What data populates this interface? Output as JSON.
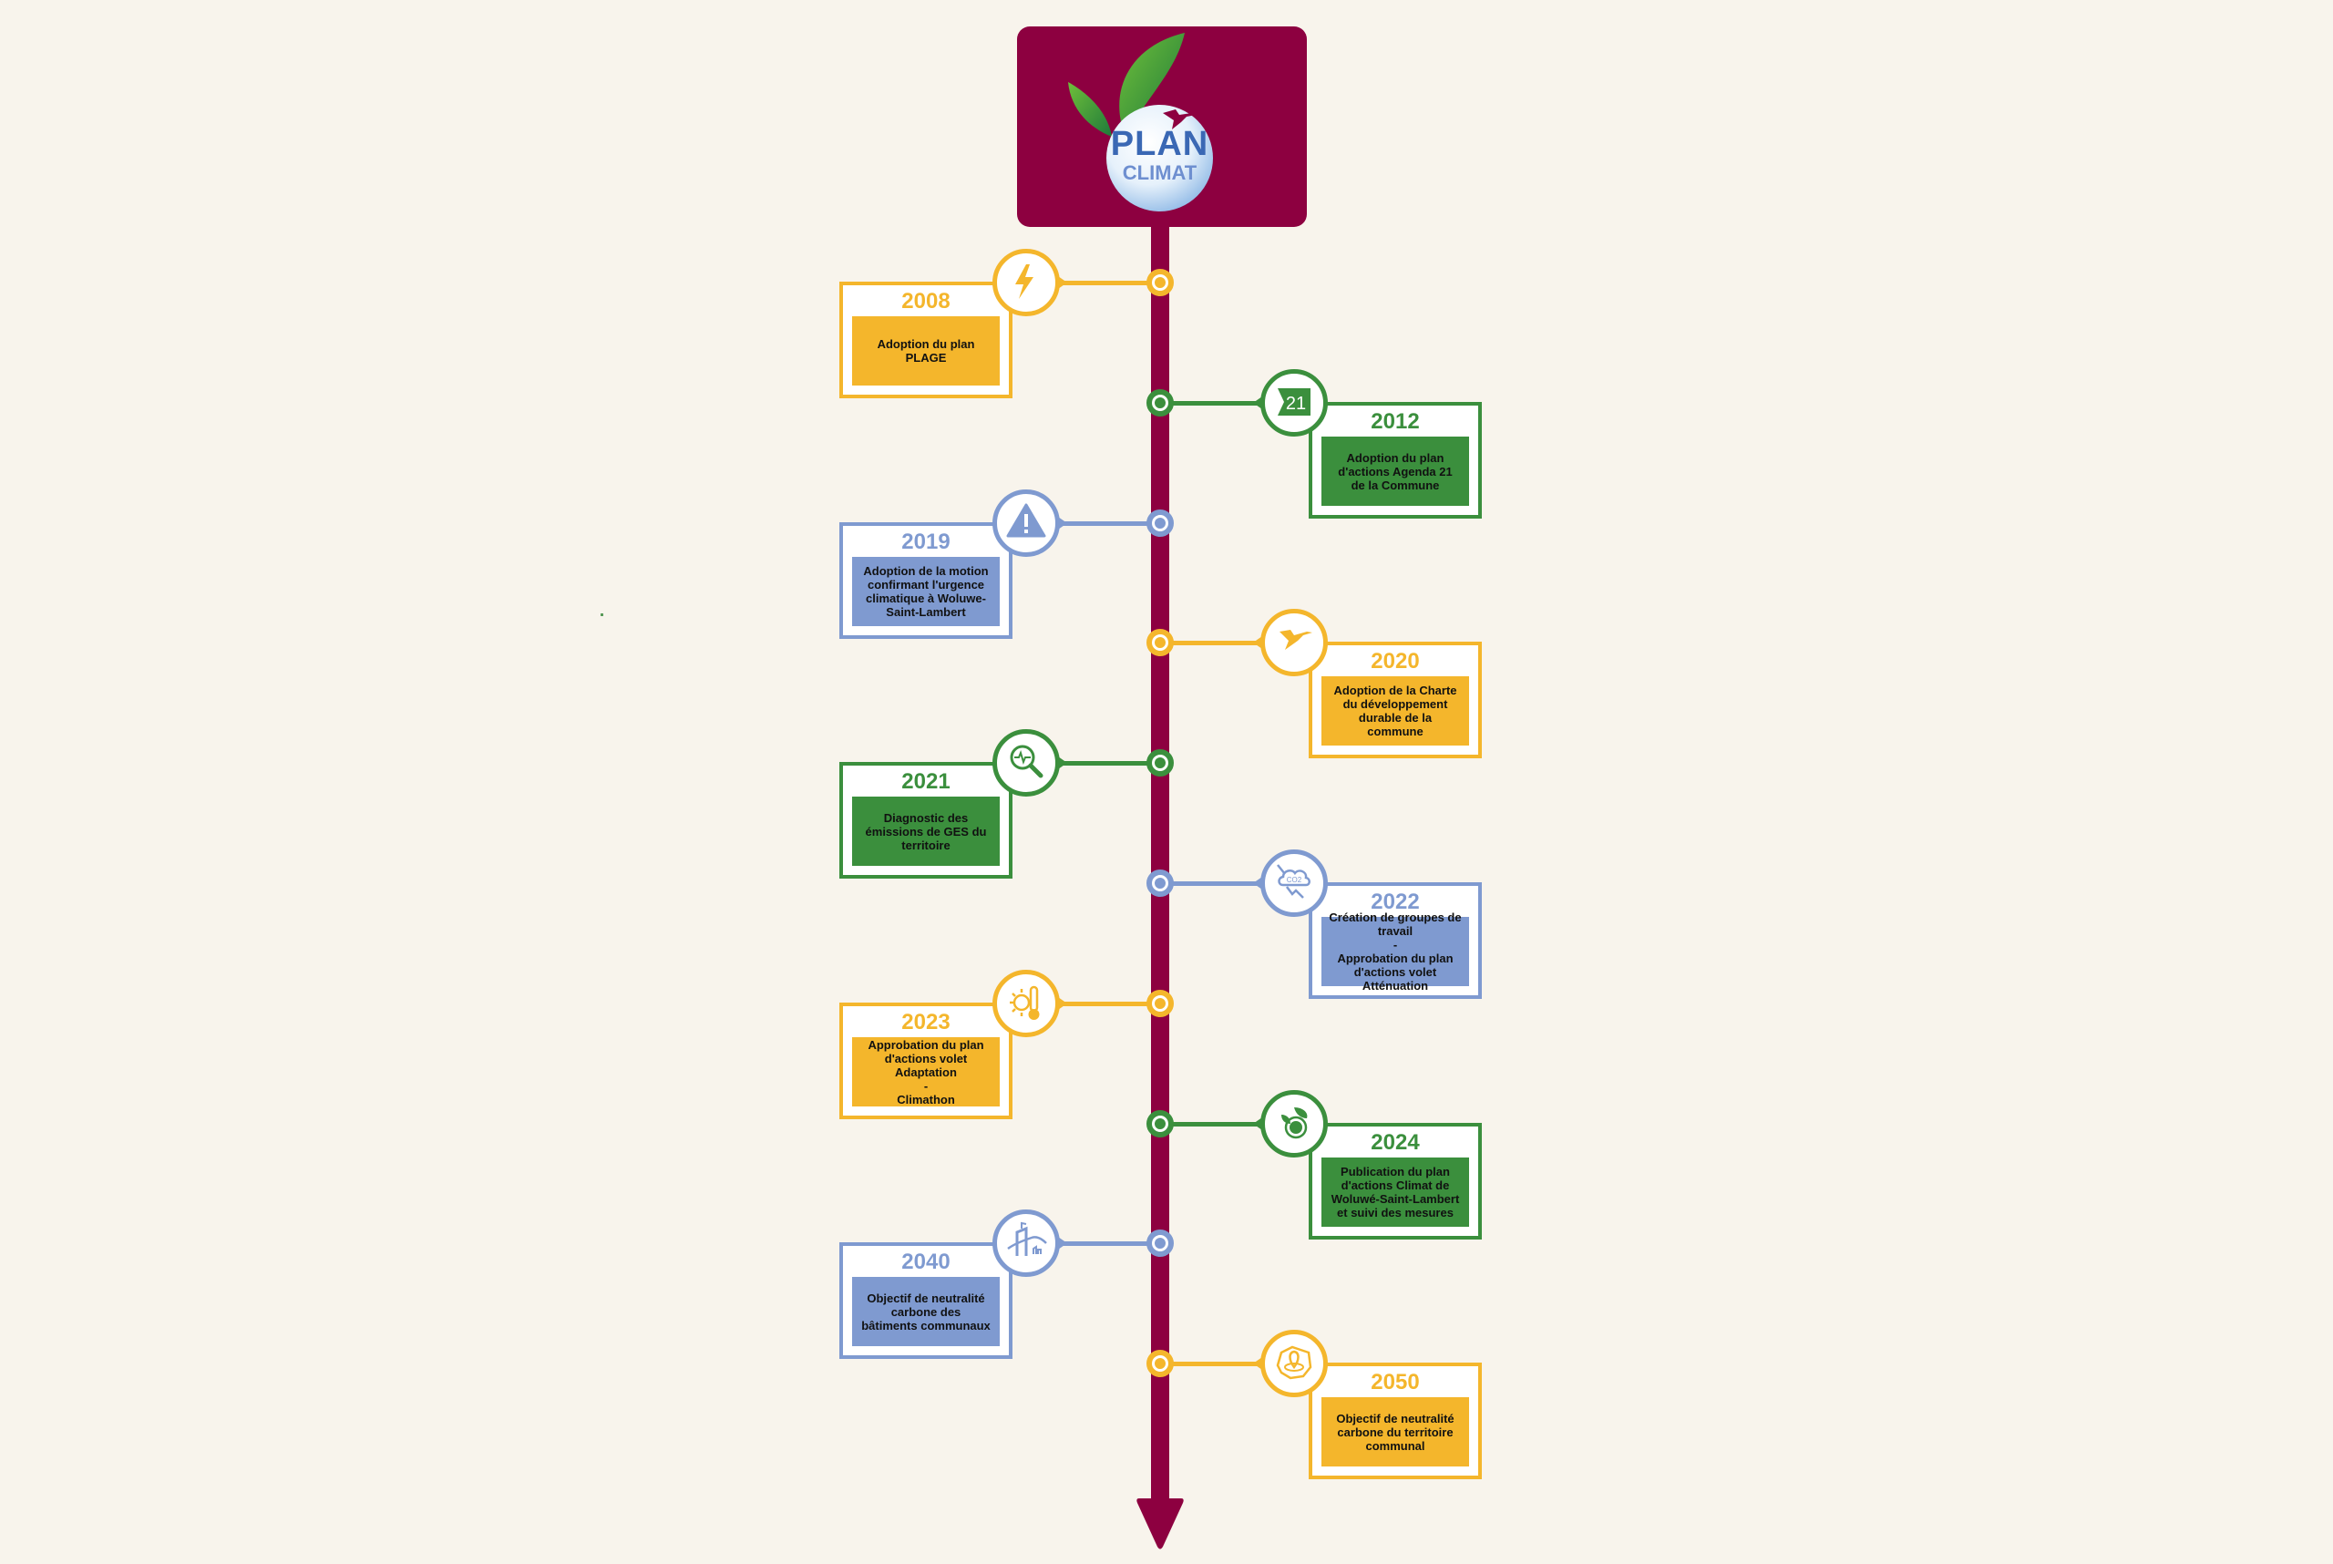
{
  "title": {
    "line1": "PLAN",
    "line2": "CLIMAT"
  },
  "colors": {
    "background": "#f8f4ec",
    "spine": "#8d0040",
    "yellow": "#f4b62c",
    "green": "#3b8f3d",
    "blue": "#7f9ad0"
  },
  "events": [
    {
      "year": "2008",
      "side": "left",
      "color": "yellow",
      "icon": "lightning-icon",
      "text": "Adoption du plan\nPLAGE"
    },
    {
      "year": "2012",
      "side": "right",
      "color": "green",
      "icon": "agenda-21-icon",
      "icon_text": "21",
      "text": "Adoption du plan\nd'actions Agenda 21\nde la Commune"
    },
    {
      "year": "2019",
      "side": "left",
      "color": "blue",
      "icon": "warning-icon",
      "text": "Adoption de la motion\nconfirmant l'urgence\nclimatique à Woluwe-\nSaint-Lambert"
    },
    {
      "year": "2020",
      "side": "right",
      "color": "yellow",
      "icon": "heron-icon",
      "text": "Adoption de la Charte\ndu développement\ndurable de la\ncommune"
    },
    {
      "year": "2021",
      "side": "left",
      "color": "green",
      "icon": "magnifier-pulse-icon",
      "text": "Diagnostic des\némissions de GES du\nterritoire"
    },
    {
      "year": "2022",
      "side": "right",
      "color": "blue",
      "icon": "cloud-co2-decrease-icon",
      "text": "Création de groupes de\ntravail\n-\nApprobation du plan\nd'actions volet\nAtténuation"
    },
    {
      "year": "2023",
      "side": "left",
      "color": "yellow",
      "icon": "sun-thermometer-icon",
      "text": "Approbation du plan\nd'actions volet\nAdaptation\n-\nClimathon"
    },
    {
      "year": "2024",
      "side": "right",
      "color": "green",
      "icon": "leaf-target-icon",
      "text": "Publication du plan\nd'actions Climat de\nWoluwé-Saint-Lambert\net suivi des mesures"
    },
    {
      "year": "2040",
      "side": "left",
      "color": "blue",
      "icon": "town-hall-icon",
      "text": "Objectif de neutralité\ncarbone des\nbâtiments communaux"
    },
    {
      "year": "2050",
      "side": "right",
      "color": "yellow",
      "icon": "territory-map-pin-icon",
      "text": "Objectif de neutralité\ncarbone du territoire\ncommunal"
    }
  ]
}
